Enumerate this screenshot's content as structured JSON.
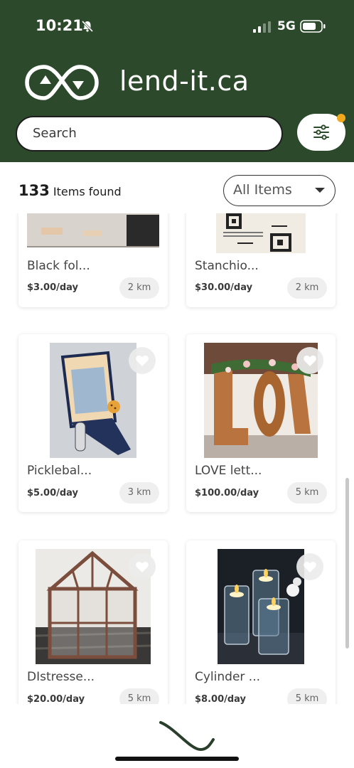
{
  "status": {
    "time": "10:21",
    "network": "5G"
  },
  "brand": {
    "name": "lend-it.ca"
  },
  "search": {
    "placeholder": "Search"
  },
  "results": {
    "count": "133",
    "label": " Items found"
  },
  "filter": {
    "selected": "All Items"
  },
  "listings": [
    {
      "title": "Black fol...",
      "price": "$3.00",
      "unit": "/day",
      "distance": "2 km"
    },
    {
      "title": "Stanchio...",
      "price": "$30.00",
      "unit": "/day",
      "distance": "2 km"
    },
    {
      "title": "Picklebal...",
      "price": "$5.00",
      "unit": "/day",
      "distance": "3 km"
    },
    {
      "title": "LOVE lett...",
      "price": "$100.00",
      "unit": "/day",
      "distance": "5 km"
    },
    {
      "title": "DIstresse...",
      "price": "$20.00",
      "unit": "/day",
      "distance": "5 km"
    },
    {
      "title": "Cylinder ...",
      "price": "$8.00",
      "unit": "/day",
      "distance": "5 km"
    }
  ],
  "colors": {
    "header": "#2c4a2b",
    "accent_dot": "#f2a91c"
  }
}
